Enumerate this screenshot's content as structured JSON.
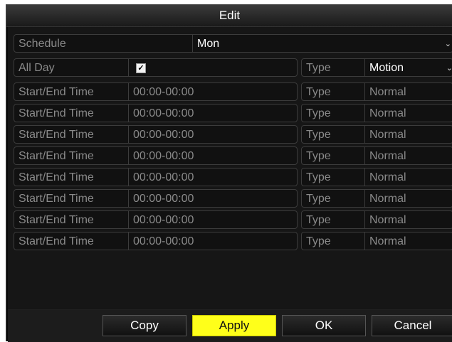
{
  "dialog": {
    "title": "Edit"
  },
  "schedule": {
    "label": "Schedule",
    "value": "Mon"
  },
  "all_day": {
    "label": "All Day",
    "checked": true,
    "type_label": "Type",
    "type_value": "Motion"
  },
  "periods": [
    {
      "label": "Start/End Time",
      "time": "00:00-00:00",
      "type_label": "Type",
      "type_value": "Normal"
    },
    {
      "label": "Start/End Time",
      "time": "00:00-00:00",
      "type_label": "Type",
      "type_value": "Normal"
    },
    {
      "label": "Start/End Time",
      "time": "00:00-00:00",
      "type_label": "Type",
      "type_value": "Normal"
    },
    {
      "label": "Start/End Time",
      "time": "00:00-00:00",
      "type_label": "Type",
      "type_value": "Normal"
    },
    {
      "label": "Start/End Time",
      "time": "00:00-00:00",
      "type_label": "Type",
      "type_value": "Normal"
    },
    {
      "label": "Start/End Time",
      "time": "00:00-00:00",
      "type_label": "Type",
      "type_value": "Normal"
    },
    {
      "label": "Start/End Time",
      "time": "00:00-00:00",
      "type_label": "Type",
      "type_value": "Normal"
    },
    {
      "label": "Start/End Time",
      "time": "00:00-00:00",
      "type_label": "Type",
      "type_value": "Normal"
    }
  ],
  "buttons": {
    "copy": "Copy",
    "apply": "Apply",
    "ok": "OK",
    "cancel": "Cancel"
  },
  "colors": {
    "accent": "#ffff1a",
    "background": "#0a0a0a",
    "text_dim": "#8a8a8a"
  }
}
